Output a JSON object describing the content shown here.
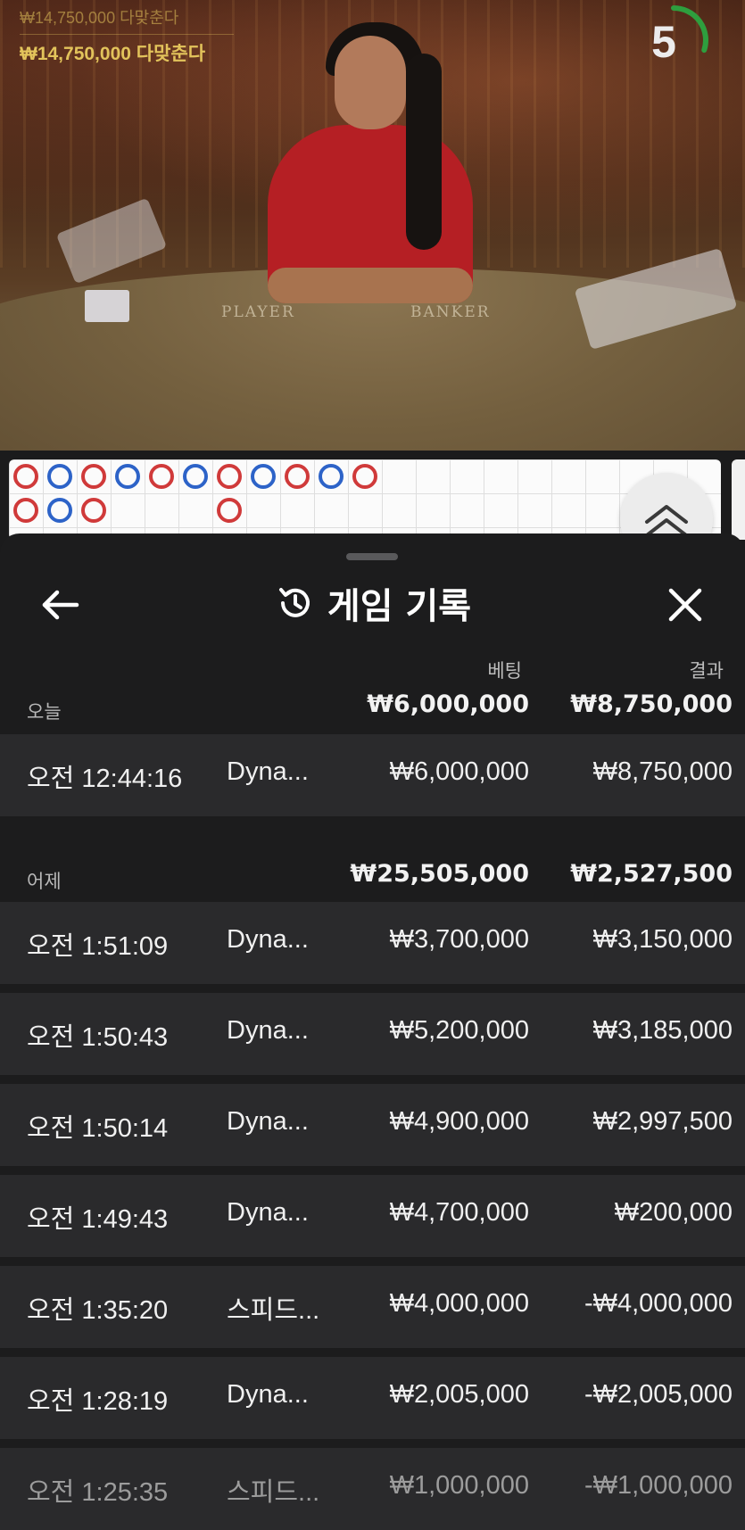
{
  "live_video": {
    "win_amount": "₩14,750,000",
    "win_label": "다맞춘다",
    "prev_overlay": "₩14,750,000 다맞춘다",
    "table_labels": [
      "PLAYER",
      "BANKER"
    ],
    "countdown": "5",
    "countdown_progress": 0.3
  },
  "bead_road": {
    "row1": [
      "red",
      "blue",
      "red",
      "blue",
      "red",
      "blue",
      "red",
      "blue",
      "red",
      "blue",
      "red"
    ],
    "row2": [
      "red",
      "blue",
      "red",
      "",
      "",
      "",
      "red"
    ]
  },
  "sheet": {
    "title": "게임 기록",
    "columns": {
      "bet": "베팅",
      "result": "결과"
    },
    "groups": [
      {
        "label": "오늘",
        "bet_total": "₩6,000,000",
        "result_total": "₩8,750,000",
        "rows": [
          {
            "time": "오전 12:44:16",
            "game": "Dyna...",
            "bet": "₩6,000,000",
            "result": "₩8,750,000"
          }
        ]
      },
      {
        "label": "어제",
        "bet_total": "₩25,505,000",
        "result_total": "₩2,527,500",
        "rows": [
          {
            "time": "오전 1:51:09",
            "game": "Dyna...",
            "bet": "₩3,700,000",
            "result": "₩3,150,000"
          },
          {
            "time": "오전 1:50:43",
            "game": "Dyna...",
            "bet": "₩5,200,000",
            "result": "₩3,185,000"
          },
          {
            "time": "오전 1:50:14",
            "game": "Dyna...",
            "bet": "₩4,900,000",
            "result": "₩2,997,500"
          },
          {
            "time": "오전 1:49:43",
            "game": "Dyna...",
            "bet": "₩4,700,000",
            "result": "₩200,000"
          },
          {
            "time": "오전 1:35:20",
            "game": "스피드...",
            "bet": "₩4,000,000",
            "result": "-₩4,000,000"
          },
          {
            "time": "오전 1:28:19",
            "game": "Dyna...",
            "bet": "₩2,005,000",
            "result": "-₩2,005,000"
          },
          {
            "time": "오전 1:25:35",
            "game": "스피드...",
            "bet": "₩1,000,000",
            "result": "-₩1,000,000"
          }
        ]
      }
    ]
  },
  "colors": {
    "accent_gold": "#e2c35b",
    "timer_green": "#2e9e3e",
    "banker_red": "#d03a3a",
    "player_blue": "#2d63c8"
  }
}
